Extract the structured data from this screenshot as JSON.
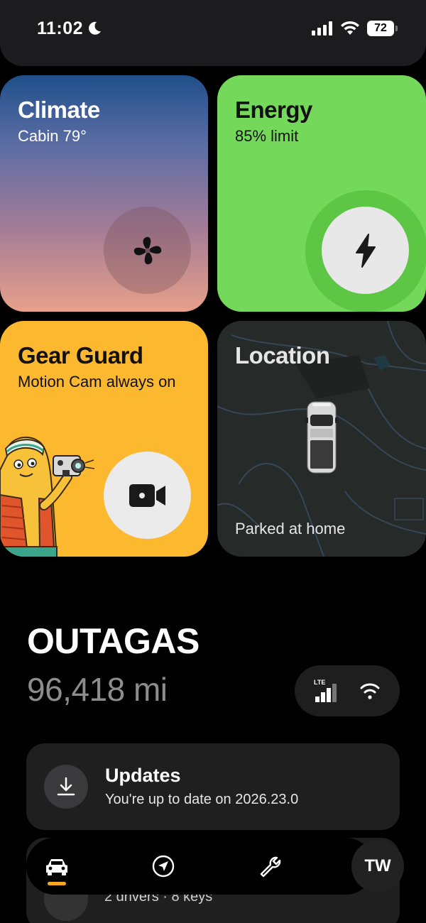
{
  "status_bar": {
    "time": "11:02",
    "battery": "72",
    "icons": [
      "moon-icon",
      "cellular-signal-icon",
      "wifi-icon",
      "battery-icon"
    ]
  },
  "tiles": {
    "climate": {
      "title": "Climate",
      "subtitle": "Cabin 79°",
      "icon": "fan-icon"
    },
    "energy": {
      "title": "Energy",
      "subtitle": "85% limit",
      "icon": "lightning-bolt-icon",
      "color": "#74d95a"
    },
    "gear_guard": {
      "title": "Gear Guard",
      "subtitle": "Motion Cam always on",
      "icon": "video-camera-icon",
      "color": "#fcb82e"
    },
    "location": {
      "title": "Location",
      "status": "Parked at home",
      "icon": "truck-icon"
    }
  },
  "vehicle": {
    "name": "OUTAGAS",
    "mileage": "96,418 mi",
    "connectivity": {
      "lte_label": "LTE",
      "icons": [
        "lte-signal-icon",
        "wifi-icon"
      ]
    }
  },
  "updates": {
    "title": "Updates",
    "subtitle": "You're up to date on 2026.23.0",
    "icon": "download-icon"
  },
  "drivers": {
    "text": "2 drivers · 8 keys"
  },
  "tab_bar": {
    "tabs": [
      {
        "name": "vehicle",
        "icon": "car-icon",
        "active": true
      },
      {
        "name": "navigation",
        "icon": "navigation-arrow-icon",
        "active": false
      },
      {
        "name": "service",
        "icon": "wrench-icon",
        "active": false
      }
    ],
    "profile_initials": "TW",
    "accent": "#f5a623"
  }
}
